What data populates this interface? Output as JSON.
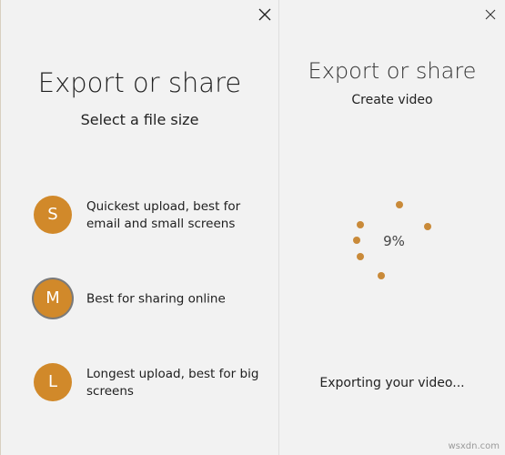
{
  "left_panel": {
    "title": "Export or share",
    "subtitle": "Select a file size",
    "close_label": "Close",
    "options": [
      {
        "letter": "S",
        "text": "Quickest upload, best for email and small screens"
      },
      {
        "letter": "M",
        "text": "Best for sharing online"
      },
      {
        "letter": "L",
        "text": "Longest upload, best for big screens"
      }
    ]
  },
  "right_panel": {
    "title": "Export or share",
    "subtitle": "Create video",
    "progress_percent": "9%",
    "progress_value": 9,
    "status": "Exporting your video...",
    "close_label": "Close"
  },
  "watermark": "wsxdn.com",
  "colors": {
    "accent": "#d1892a",
    "spinner_dot": "#c98a39",
    "background": "#f2f2f2",
    "selected_ring": "#7a7a7a"
  },
  "icons": {
    "close": "close-icon"
  }
}
